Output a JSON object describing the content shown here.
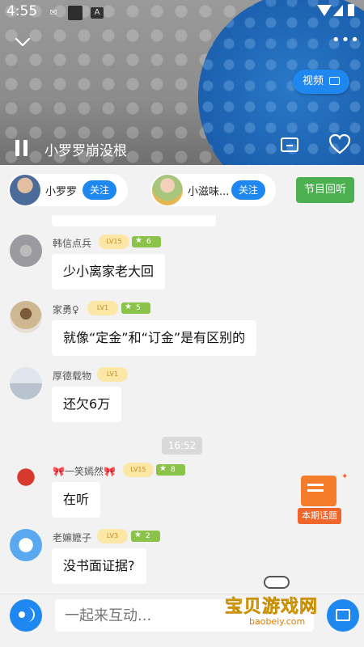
{
  "status_bar": {
    "time": "4:55"
  },
  "player": {
    "title": "小罗罗崩没根",
    "video_label": "视频",
    "more_label": "•••"
  },
  "hosts": [
    {
      "name": "小罗罗",
      "follow_label": "关注"
    },
    {
      "name": "小滋味...",
      "follow_label": "关注"
    }
  ],
  "replay_label": "节目回听",
  "topic_badge": {
    "label": "本期话题"
  },
  "messages": [
    {
      "user": "韩信点兵",
      "level": "LV15",
      "score": "6",
      "text": "少小离家老大回"
    },
    {
      "user": "家勇♀",
      "level": "LV1",
      "score": "5",
      "text": "就像“定金”和“订金”是有区别的"
    },
    {
      "user": "厚德载物",
      "level": "LV1",
      "score": "",
      "text": "还欠6万"
    },
    {
      "user": "🎀一笑嫣然🎀",
      "level": "LV15",
      "score": "8",
      "text": "在听"
    },
    {
      "user": "老嫲嬷子",
      "level": "LV3",
      "score": "2",
      "text": "没书面证据?"
    }
  ],
  "time_divider": "16:52",
  "input": {
    "placeholder": "一起来互动..."
  },
  "watermark": {
    "title": "宝贝游戏网",
    "domain": "baobeiy.com"
  },
  "colors": {
    "accent": "#1e88f0",
    "replay_green": "#4caf50",
    "topic_orange": "#f57c2b",
    "level_bg": "#fde7a6",
    "star_green": "#8bc34a"
  }
}
